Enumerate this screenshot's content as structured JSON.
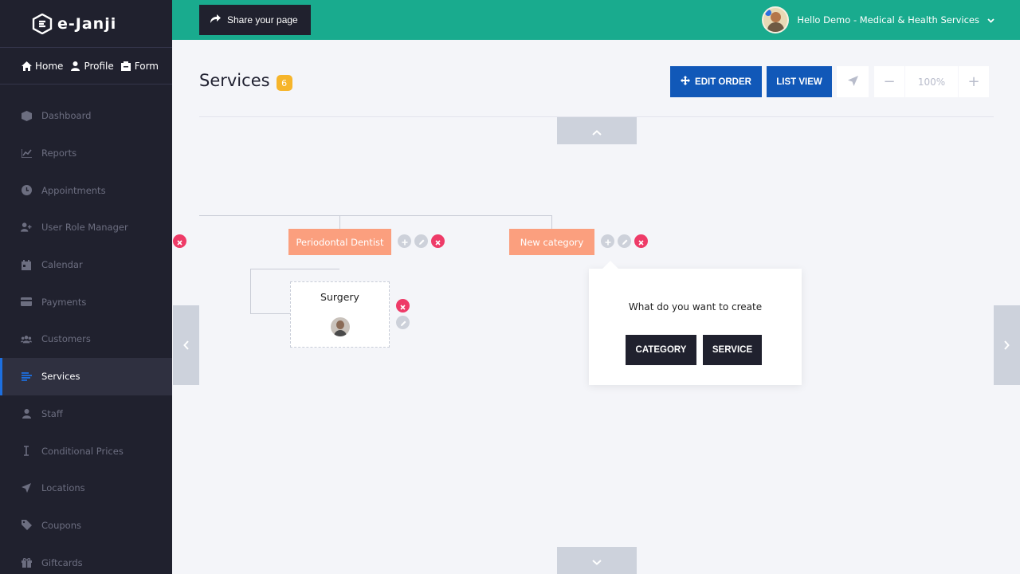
{
  "app": {
    "brand": "e-Janji"
  },
  "quicknav": [
    {
      "label": "Home",
      "icon": "home-icon"
    },
    {
      "label": "Profile",
      "icon": "user-icon"
    },
    {
      "label": "Form",
      "icon": "form-icon"
    }
  ],
  "sidebar": {
    "items": [
      {
        "label": "Dashboard",
        "icon": "cube-icon"
      },
      {
        "label": "Reports",
        "icon": "chart-icon"
      },
      {
        "label": "Appointments",
        "icon": "clock-icon"
      },
      {
        "label": "User Role Manager",
        "icon": "user-plus-icon"
      },
      {
        "label": "Calendar",
        "icon": "calendar-icon"
      },
      {
        "label": "Payments",
        "icon": "credit-card-icon"
      },
      {
        "label": "Customers",
        "icon": "users-icon"
      },
      {
        "label": "Services",
        "icon": "list-icon",
        "active": true
      },
      {
        "label": "Staff",
        "icon": "user-icon"
      },
      {
        "label": "Conditional Prices",
        "icon": "cursor-icon"
      },
      {
        "label": "Locations",
        "icon": "location-arrow-icon"
      },
      {
        "label": "Coupons",
        "icon": "tag-icon"
      },
      {
        "label": "Giftcards",
        "icon": "gift-icon"
      }
    ]
  },
  "topbar": {
    "share_label": "Share your page",
    "user_greeting": "Hello Demo - Medical & Health Services"
  },
  "header": {
    "title": "Services",
    "count": "6",
    "edit_order_label": "EDIT ORDER",
    "list_view_label": "LIST VIEW",
    "zoom_level": "100%",
    "zoom_out_label": "−",
    "zoom_in_label": "+"
  },
  "tree": {
    "category_1": "Periodontal Dentistry",
    "category_2": "New category",
    "service_1": "Surgery"
  },
  "popup": {
    "question": "What do you want to create",
    "category_label": "CATEGORY",
    "service_label": "SERVICE"
  },
  "colors": {
    "sidebar_bg": "#20212e",
    "topbar_bg": "#19ab8e",
    "primary_blue": "#1158b8",
    "category_node": "#fb9f7e",
    "delete_red": "#ee3b68",
    "badge_orange": "#f6b52b"
  }
}
